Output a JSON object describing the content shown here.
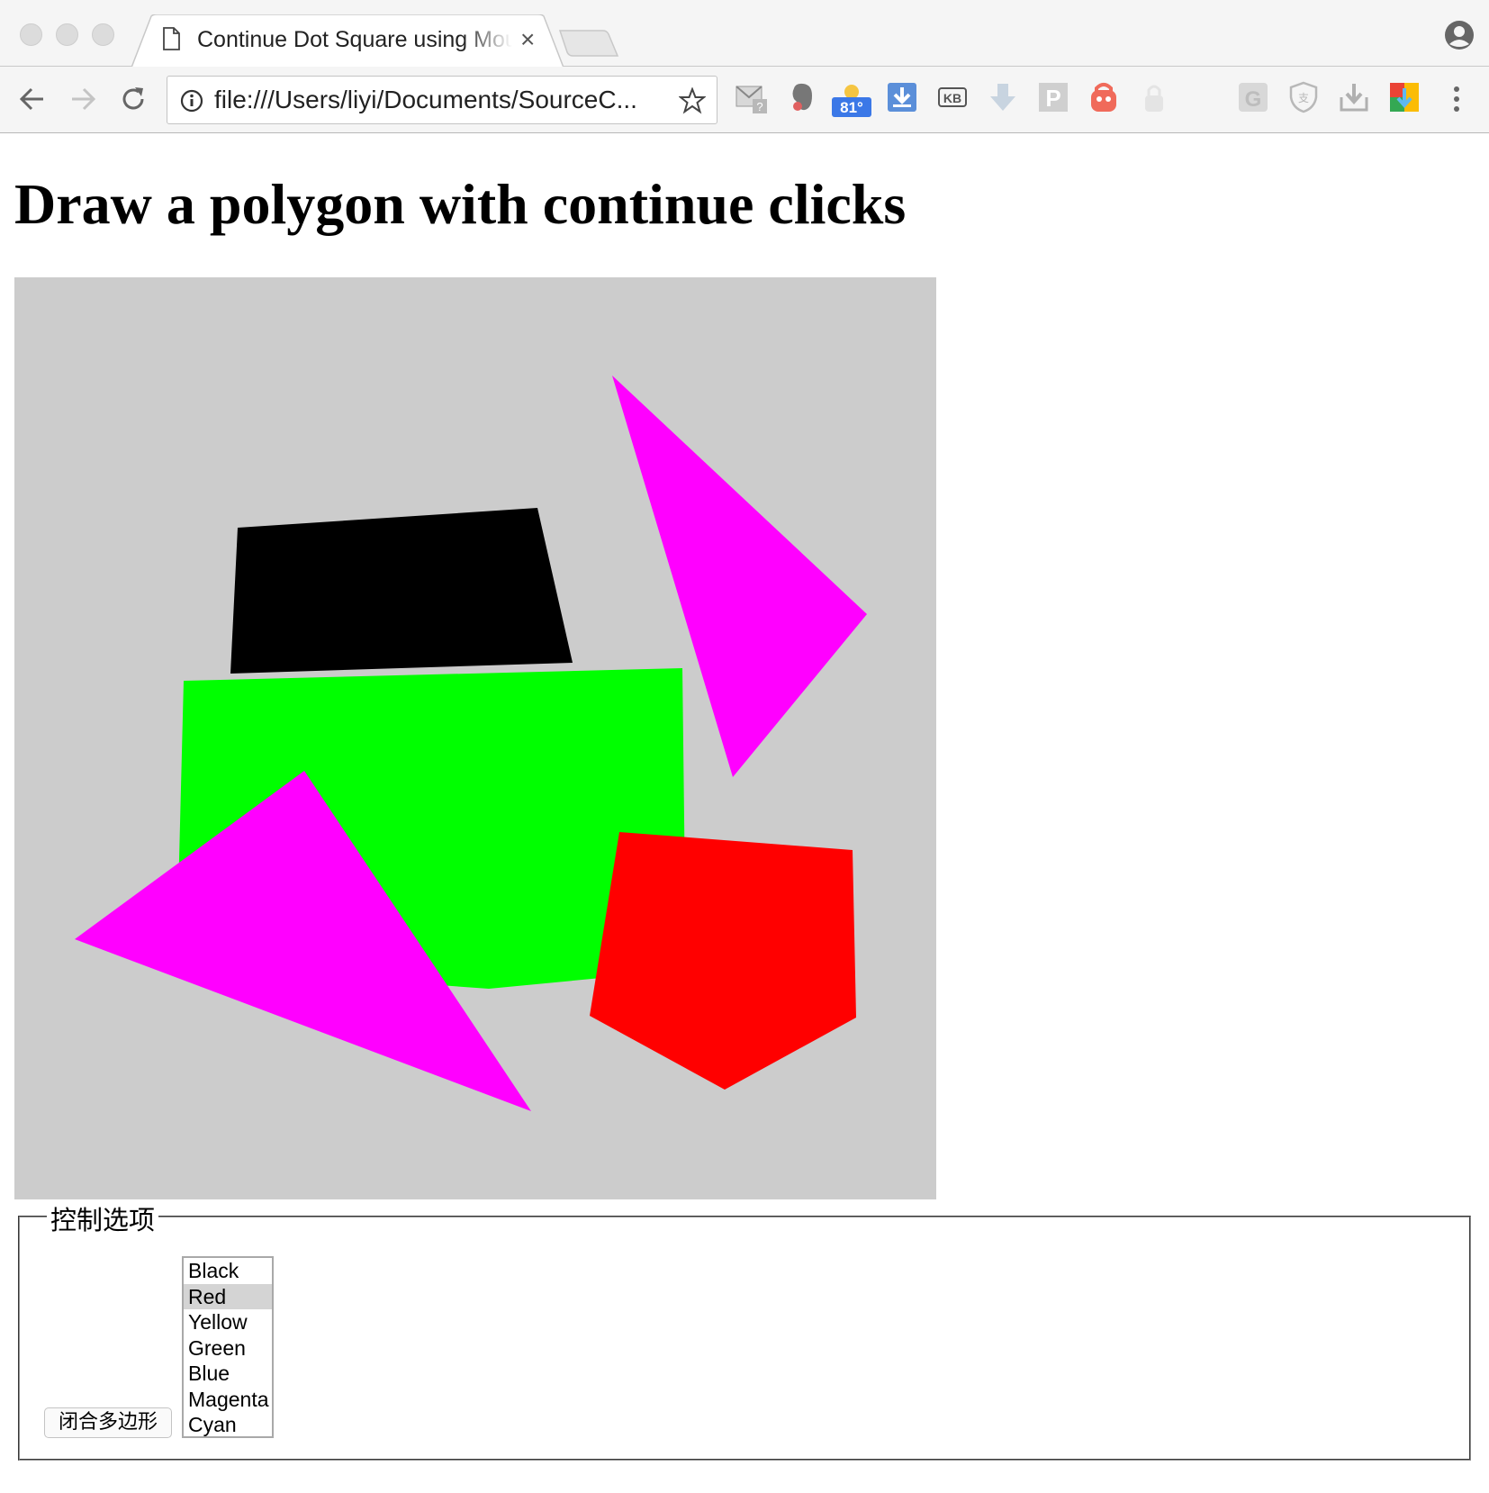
{
  "browser": {
    "tab_title": "Continue Dot Square using Mouse",
    "tab_close_glyph": "×",
    "url": "file:///Users/liyi/Documents/SourceC...",
    "weather_badge": "81°",
    "extensions": [
      "gmail-checker-icon",
      "evernote-icon",
      "weather-icon",
      "download-icon",
      "kb-icon",
      "arrow-down-icon",
      "p-icon",
      "vpn-icon",
      "lock-icon",
      "g-icon",
      "shield-icon",
      "save-icon",
      "drive-icon"
    ]
  },
  "page": {
    "title": "Draw a polygon with continue clicks"
  },
  "canvas": {
    "background": "#cccccc",
    "polygons": [
      {
        "name": "black-quadrilateral",
        "color": "#000000",
        "points": [
          [
            248,
            278
          ],
          [
            581,
            256
          ],
          [
            620,
            428
          ],
          [
            240,
            440
          ]
        ]
      },
      {
        "name": "magenta-triangle-top",
        "color": "#ff00ff",
        "points": [
          [
            664,
            109
          ],
          [
            947,
            374
          ],
          [
            798,
            555
          ]
        ]
      },
      {
        "name": "green-pentagon",
        "color": "#00ff00",
        "points": [
          [
            188,
            448
          ],
          [
            742,
            434
          ],
          [
            746,
            769
          ],
          [
            527,
            790
          ],
          [
            180,
            765
          ]
        ]
      },
      {
        "name": "magenta-triangle-left",
        "color": "#ff00ff",
        "points": [
          [
            322,
            548
          ],
          [
            574,
            926
          ],
          [
            67,
            735
          ]
        ]
      },
      {
        "name": "red-pentagon",
        "color": "#ff0000",
        "points": [
          [
            672,
            616
          ],
          [
            931,
            636
          ],
          [
            935,
            822
          ],
          [
            789,
            902
          ],
          [
            639,
            820
          ]
        ]
      }
    ]
  },
  "controls": {
    "legend": "控制选项",
    "close_button_label": "闭合多边形",
    "colors": [
      "Black",
      "Red",
      "Yellow",
      "Green",
      "Blue",
      "Magenta",
      "Cyan"
    ],
    "selected_color": "Red"
  }
}
